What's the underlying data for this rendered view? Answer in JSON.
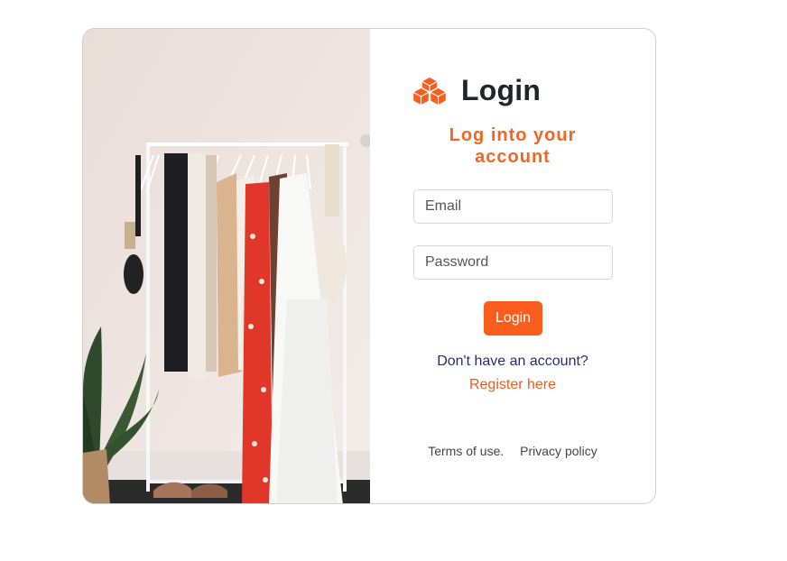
{
  "header": {
    "title": "Login",
    "logo_icon": "cubes-icon"
  },
  "subtitle": {
    "line1": "Log into your",
    "line2": "account"
  },
  "form": {
    "email_placeholder": "Email",
    "email_value": "",
    "password_placeholder": "Password",
    "password_value": "",
    "login_label": "Login"
  },
  "signup": {
    "prompt": "Don't have an account?",
    "link_label": "Register here"
  },
  "footer": {
    "terms_label": "Terms of use.",
    "privacy_label": "Privacy policy"
  },
  "colors": {
    "accent": "#fa5d1c",
    "subtitle": "#f26522",
    "prompt_text": "#2b2c6e"
  }
}
